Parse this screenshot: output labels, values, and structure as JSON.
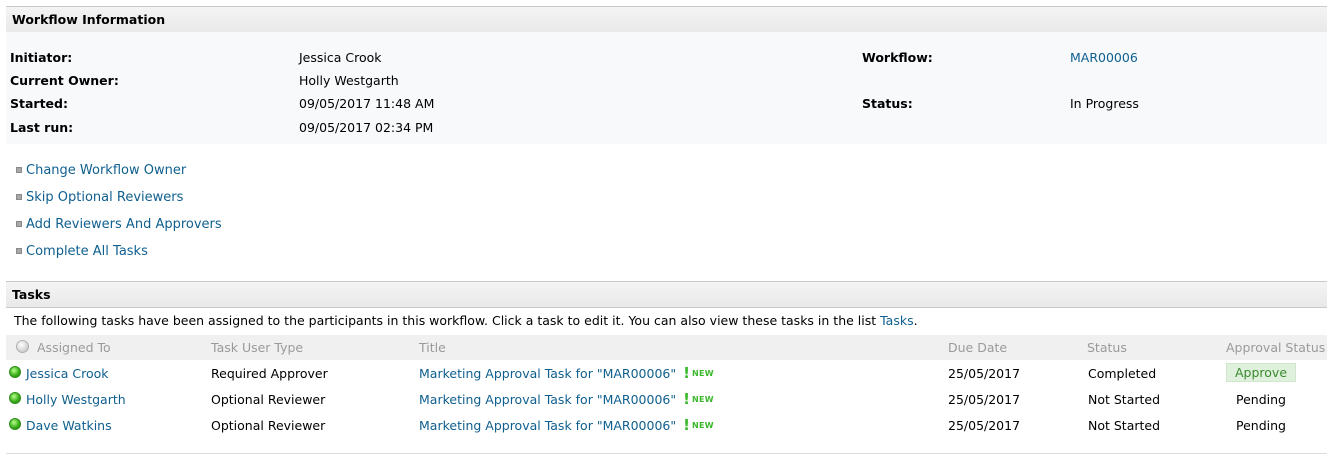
{
  "workflow_info": {
    "header": "Workflow Information",
    "initiator_label": "Initiator:",
    "initiator": "Jessica Crook",
    "owner_label": "Current Owner:",
    "owner": "Holly Westgarth",
    "started_label": "Started:",
    "started": "09/05/2017 11:48 AM",
    "lastrun_label": "Last run:",
    "lastrun": "09/05/2017 02:34 PM",
    "workflow_label": "Workflow:",
    "workflow": "MAR00006",
    "status_label": "Status:",
    "status": "In Progress"
  },
  "actions": [
    "Change Workflow Owner",
    "Skip Optional Reviewers",
    "Add Reviewers And Approvers",
    "Complete All Tasks"
  ],
  "tasks": {
    "header": "Tasks",
    "intro": "The following tasks have been assigned to the participants in this workflow. Click a task to edit it. You can also view these tasks in the list ",
    "intro_link": "Tasks",
    "intro_end": ".",
    "columns": [
      "Assigned To",
      "Task User Type",
      "Title",
      "Due Date",
      "Status",
      "Approval Status"
    ],
    "new_label": "NEW",
    "rows": [
      {
        "assigned": "Jessica Crook",
        "type": "Required Approver",
        "title": "Marketing Approval Task for \"MAR00006\"",
        "due": "25/05/2017",
        "status": "Completed",
        "approval": "Approve"
      },
      {
        "assigned": "Holly Westgarth",
        "type": "Optional Reviewer",
        "title": "Marketing Approval Task for \"MAR00006\"",
        "due": "25/05/2017",
        "status": "Not Started",
        "approval": "Pending"
      },
      {
        "assigned": "Dave Watkins",
        "type": "Optional Reviewer",
        "title": "Marketing Approval Task for \"MAR00006\"",
        "due": "25/05/2017",
        "status": "Not Started",
        "approval": "Pending"
      }
    ]
  },
  "colors": {
    "link": "#0f5f8f",
    "new_badge": "#3bb82c",
    "approve_bg": "#dff1dc"
  }
}
